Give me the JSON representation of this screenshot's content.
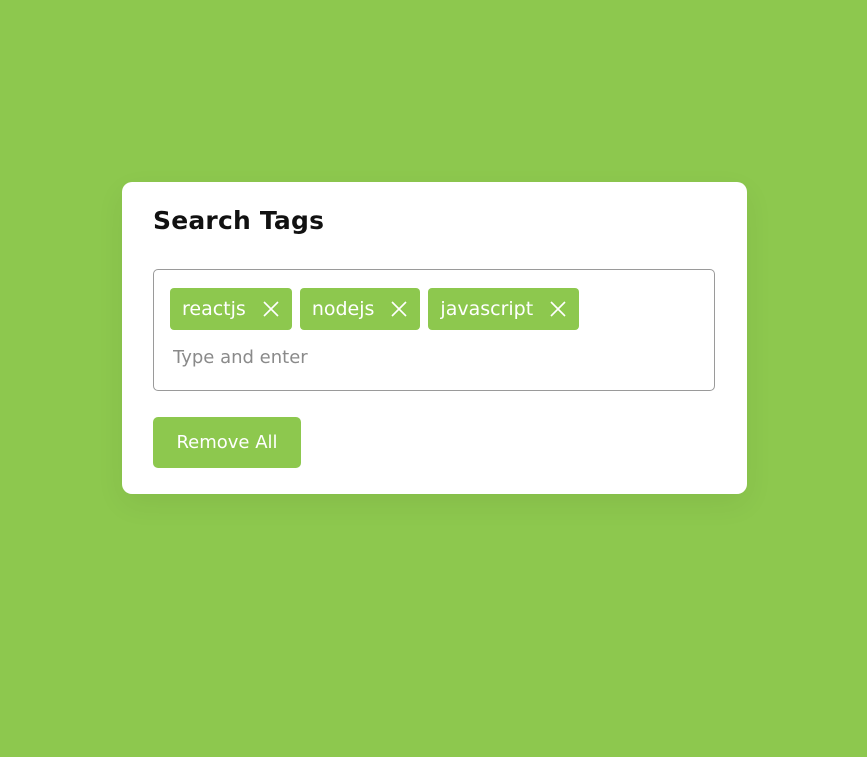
{
  "card": {
    "title": "Search Tags",
    "tags": [
      {
        "label": "reactjs",
        "close_icon": "close-icon"
      },
      {
        "label": "nodejs",
        "close_icon": "close-icon"
      },
      {
        "label": "javascript",
        "close_icon": "close-icon"
      }
    ],
    "input": {
      "value": "",
      "placeholder": "Type and enter"
    },
    "remove_all_label": "Remove All"
  },
  "colors": {
    "background": "#8dc84e",
    "accent": "#8dc84e",
    "card": "#ffffff"
  }
}
